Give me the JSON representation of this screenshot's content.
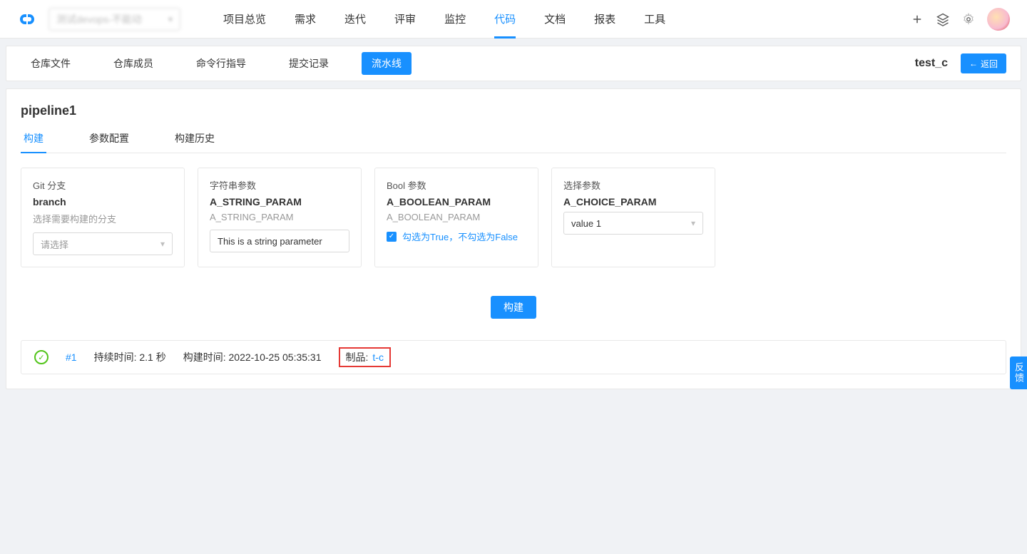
{
  "topnav": {
    "project_placeholder": "测试devops-不能动",
    "tabs": [
      "项目总览",
      "需求",
      "迭代",
      "评审",
      "监控",
      "代码",
      "文档",
      "报表",
      "工具"
    ],
    "active_index": 5
  },
  "subnav": {
    "tabs": [
      "仓库文件",
      "仓库成员",
      "命令行指导",
      "提交记录",
      "流水线"
    ],
    "active_index": 4,
    "repo_name": "test_c",
    "back_label": "返回"
  },
  "pipeline": {
    "title": "pipeline1",
    "inner_tabs": [
      "构建",
      "参数配置",
      "构建历史"
    ],
    "active_inner": 0
  },
  "params": {
    "git": {
      "type_label": "Git 分支",
      "name": "branch",
      "desc": "选择需要构建的分支",
      "placeholder": "请选择"
    },
    "string": {
      "type_label": "字符串参数",
      "name": "A_STRING_PARAM",
      "desc": "A_STRING_PARAM",
      "value": "This is a string parameter"
    },
    "bool": {
      "type_label": "Bool 参数",
      "name": "A_BOOLEAN_PARAM",
      "desc": "A_BOOLEAN_PARAM",
      "check_label": "勾选为True，不勾选为False",
      "checked": true
    },
    "choice": {
      "type_label": "选择参数",
      "name": "A_CHOICE_PARAM",
      "selected": "value 1"
    }
  },
  "build_button": "构建",
  "build_result": {
    "id": "#1",
    "duration_label": "持续时间:",
    "duration_value": "2.1 秒",
    "time_label": "构建时间:",
    "time_value": "2022-10-25 05:35:31",
    "artifact_label": "制品:",
    "artifact_link": "t-c"
  },
  "feedback_label": "反馈"
}
